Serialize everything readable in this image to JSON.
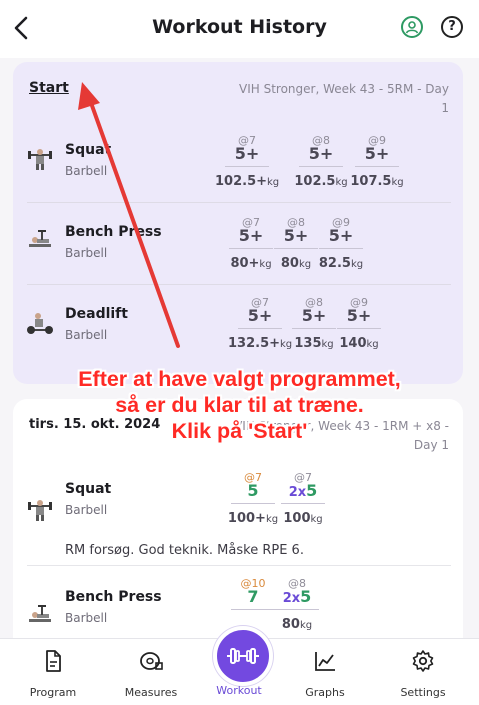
{
  "header": {
    "title": "Workout History",
    "help_glyph": "?",
    "icons": {
      "back": "back-arrow-icon",
      "profile": "user-profile-icon",
      "help": "help-icon"
    }
  },
  "planned": {
    "start_label": "Start",
    "program_line1": "VIH Stronger, Week 43 - 5RM - Day",
    "program_line2": "1",
    "exercises": [
      {
        "name": "Squat",
        "equipment": "Barbell",
        "sets": [
          {
            "rpe": "@7",
            "reps": "5+",
            "weight": "102.5+",
            "unit": "kg"
          },
          {
            "rpe": "@8",
            "reps": "5+",
            "weight": "102.5",
            "unit": "kg"
          },
          {
            "rpe": "@9",
            "reps": "5+",
            "weight": "107.5",
            "unit": "kg"
          }
        ]
      },
      {
        "name": "Bench Press",
        "equipment": "Barbell",
        "sets": [
          {
            "rpe": "@7",
            "reps": "5+",
            "weight": "80+",
            "unit": "kg"
          },
          {
            "rpe": "@8",
            "reps": "5+",
            "weight": "80",
            "unit": "kg"
          },
          {
            "rpe": "@9",
            "reps": "5+",
            "weight": "82.5",
            "unit": "kg"
          }
        ]
      },
      {
        "name": "Deadlift",
        "equipment": "Barbell",
        "sets": [
          {
            "rpe": "@7",
            "reps": "5+",
            "weight": "132.5+",
            "unit": "kg"
          },
          {
            "rpe": "@8",
            "reps": "5+",
            "weight": "135",
            "unit": "kg"
          },
          {
            "rpe": "@9",
            "reps": "5+",
            "weight": "140",
            "unit": "kg"
          }
        ]
      }
    ]
  },
  "history": {
    "date": "tirs. 15. okt. 2024",
    "program_line1": "VIH Stronger, Week 43 - 1RM + x8 -",
    "program_line2": "Day 1",
    "exercises": [
      {
        "name": "Squat",
        "equipment": "Barbell",
        "note": "RM forsøg. God teknik. Måske RPE 6.",
        "sets": [
          {
            "rpe": "@7",
            "mult": "",
            "reps": "5",
            "weight": "100+",
            "unit": "kg"
          },
          {
            "rpe": "@7",
            "mult": "2x",
            "reps": "5",
            "weight": "100",
            "unit": "kg"
          }
        ]
      },
      {
        "name": "Bench Press",
        "equipment": "Barbell",
        "sets": [
          {
            "rpe": "@10",
            "mult": "",
            "reps": "7",
            "weight": "",
            "unit": ""
          },
          {
            "rpe": "@8",
            "mult": "2x",
            "reps": "5",
            "weight": "80",
            "unit": "kg"
          }
        ]
      }
    ]
  },
  "nav": {
    "items": [
      {
        "label": "Program",
        "icon": "document-icon"
      },
      {
        "label": "Measures",
        "icon": "tape-measure-icon"
      },
      {
        "label": "Workout",
        "icon": "dumbbell-icon"
      },
      {
        "label": "Graphs",
        "icon": "line-graph-icon"
      },
      {
        "label": "Settings",
        "icon": "gear-icon"
      }
    ],
    "active_color": "#7349e0"
  },
  "annotation": {
    "line1": "Efter at have valgt programmet,",
    "line2": "så er du klar til at træne.",
    "line3": "Klik på 'Start'",
    "color": "#ff2a25"
  },
  "colors": {
    "card_planned": "#ede9fa",
    "accent": "#7349e0",
    "green": "#2f9a63",
    "orange": "#d98a3d"
  }
}
